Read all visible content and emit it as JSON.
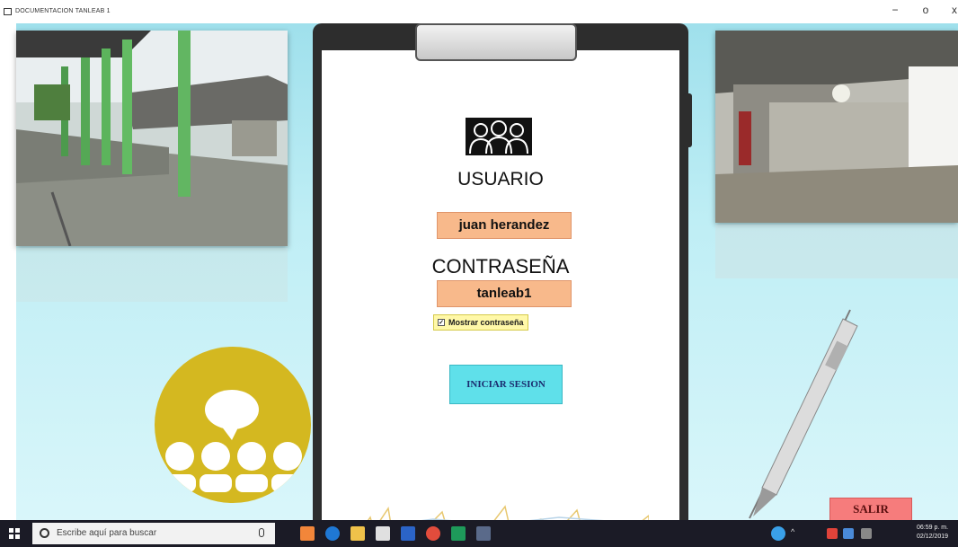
{
  "window": {
    "title": "DOCUMENTACION TANLEAB 1",
    "minimize": "−",
    "restore": "o",
    "close": "x"
  },
  "form": {
    "usuario_label": "USUARIO",
    "usuario_value": "juan herandez",
    "contrasena_label": "CONTRASEÑA",
    "contrasena_value": "tanleab1",
    "mostrar_label": "Mostrar contraseña",
    "mostrar_checked": true,
    "login_button": "INICIAR SESION"
  },
  "salir_button": "SALIR",
  "taskbar": {
    "search_placeholder": "Escribe aquí para buscar",
    "clock_time": "06:59 p. m.",
    "clock_date": "02/12/2019"
  }
}
